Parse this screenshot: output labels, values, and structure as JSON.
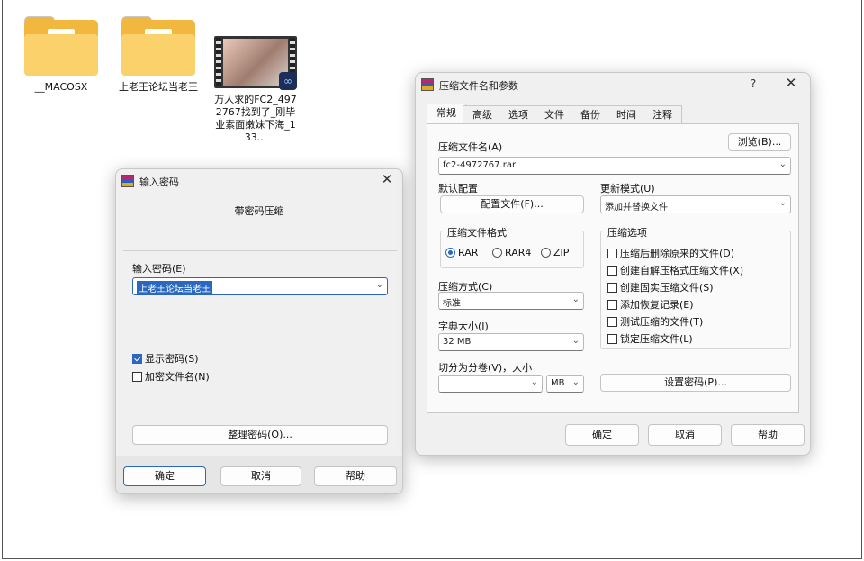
{
  "desktop": {
    "icons": [
      {
        "label": "__MACOSX",
        "kind": "folder-icon"
      },
      {
        "label": "上老王论坛当老王",
        "kind": "folder-icon"
      },
      {
        "label": "万人求的FC2_4972767找到了_刚毕业素面嫩妹下海_133...",
        "kind": "video-thumbnail-icon"
      }
    ]
  },
  "password_dialog": {
    "title": "输入密码",
    "heading": "带密码压缩",
    "field_label": "输入密码(E)",
    "field_value": "上老王论坛当老王",
    "show_password_label": "显示密码(S)",
    "show_password_checked": true,
    "encrypt_names_label": "加密文件名(N)",
    "encrypt_names_checked": false,
    "organize_button": "整理密码(O)...",
    "ok": "确定",
    "cancel": "取消",
    "help": "帮助"
  },
  "archive_dialog": {
    "title": "压缩文件名和参数",
    "help_glyph": "?",
    "close_glyph": "✕",
    "tabs": [
      "常规",
      "高级",
      "选项",
      "文件",
      "备份",
      "时间",
      "注释"
    ],
    "active_tab": "常规",
    "archive_name_label": "压缩文件名(A)",
    "browse_button": "浏览(B)...",
    "archive_name_value": "fc2-4972767.rar",
    "profile_label": "默认配置",
    "profile_button": "配置文件(F)...",
    "update_mode_label": "更新模式(U)",
    "update_mode_value": "添加并替换文件",
    "format_group_label": "压缩文件格式",
    "formats": [
      {
        "label": "RAR",
        "selected": true
      },
      {
        "label": "RAR4",
        "selected": false
      },
      {
        "label": "ZIP",
        "selected": false
      }
    ],
    "method_label": "压缩方式(C)",
    "method_value": "标准",
    "dict_label": "字典大小(I)",
    "dict_value": "32 MB",
    "split_label": "切分为分卷(V)，大小",
    "split_value": "",
    "split_unit": "MB",
    "options_group_label": "压缩选项",
    "options": [
      {
        "label": "压缩后删除原来的文件(D)",
        "checked": false
      },
      {
        "label": "创建自解压格式压缩文件(X)",
        "checked": false
      },
      {
        "label": "创建固实压缩文件(S)",
        "checked": false
      },
      {
        "label": "添加恢复记录(E)",
        "checked": false
      },
      {
        "label": "测试压缩的文件(T)",
        "checked": false
      },
      {
        "label": "锁定压缩文件(L)",
        "checked": false
      }
    ],
    "set_password_button": "设置密码(P)...",
    "ok": "确定",
    "cancel": "取消",
    "help": "帮助"
  }
}
